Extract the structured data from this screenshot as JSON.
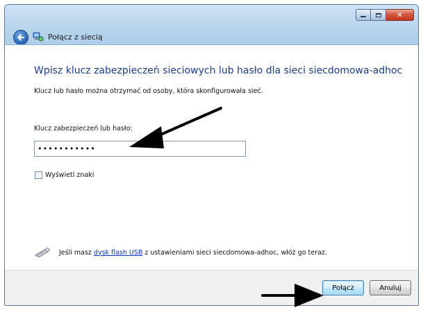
{
  "window": {
    "title": "Połącz z siecią",
    "caption_buttons": [
      "minimize-icon",
      "maximize-icon",
      "close-icon"
    ],
    "close_glyph": "✕"
  },
  "content": {
    "heading": "Wpisz klucz zabezpieczeń sieciowych lub hasło dla sieci siecdomowa-adhoc",
    "info": "Klucz lub hasło można otrzymać od osoby, która skonfigurowała sieć.",
    "field_label": "Klucz zabezpieczeń lub hasło:",
    "password_value": "•••••••••••",
    "show_chars_label": "Wyświetl znaki",
    "show_chars_checked": false,
    "usb_text_before": "Jeśli masz ",
    "usb_link": "dysk flash USB",
    "usb_text_after": " z ustawieniami sieci siecdomowa-adhoc, włóż go teraz."
  },
  "footer": {
    "connect_label": "Połącz",
    "cancel_label": "Anuluj"
  },
  "colors": {
    "heading": "#1e3d8f",
    "link": "#0033cc",
    "footer_bg": "#f0f0f0",
    "arrow": "#000000"
  }
}
